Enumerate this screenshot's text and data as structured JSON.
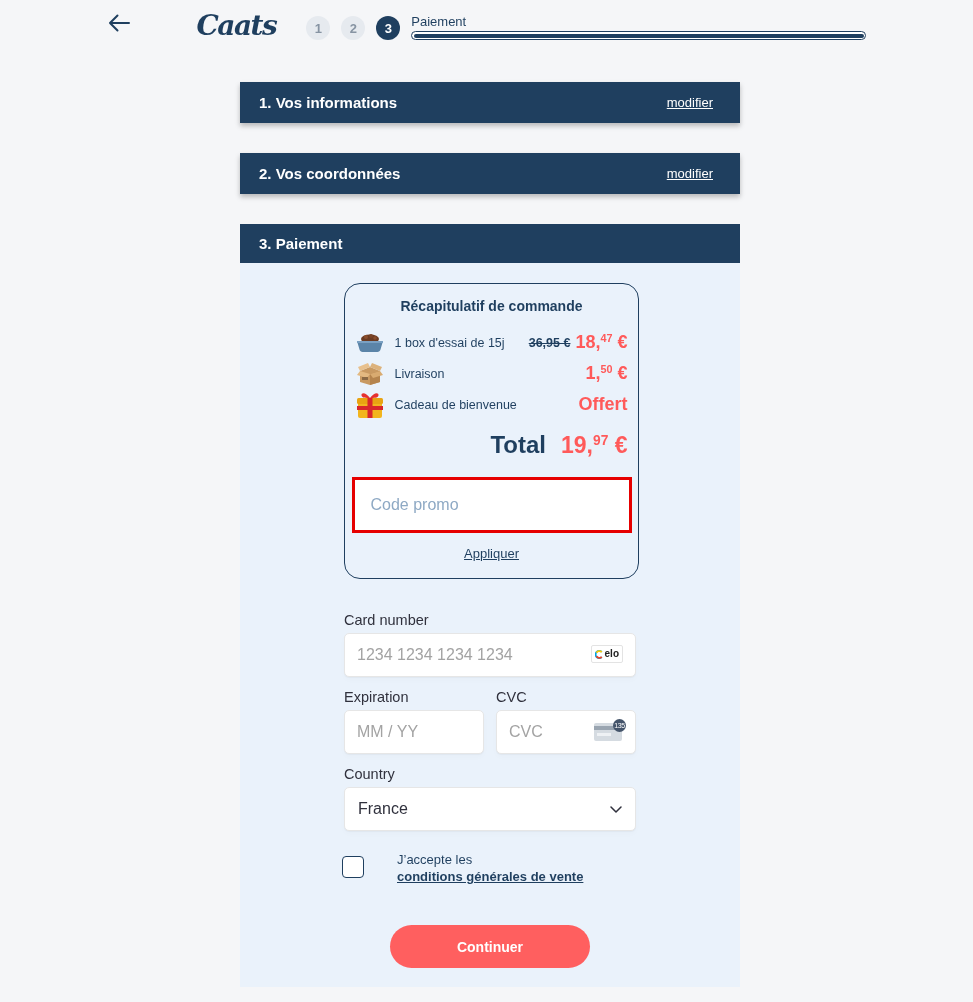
{
  "header": {
    "logo": "Caats",
    "steps": [
      {
        "label": "1",
        "selected": false
      },
      {
        "label": "2",
        "selected": false
      },
      {
        "label": "3",
        "selected": true
      }
    ],
    "step_label": "Paiement",
    "progress": {
      "level": 1
    }
  },
  "sections": [
    {
      "title": "1. Vos informations",
      "action": "modifier",
      "expanded": false
    },
    {
      "title": "2. Vos coordonnées",
      "action": "modifier",
      "expanded": false
    },
    {
      "title": "3. Paiement",
      "expanded": true
    }
  ],
  "order_summary": {
    "title": "Récapitulatif de commande",
    "items": [
      {
        "kind": "bowl",
        "label": "1 box d'essai de 15j",
        "old_price": "36,95 €",
        "price": "18,$^{47}$ €"
      },
      {
        "kind": "box",
        "label": "Livraison",
        "price": "1,$^{50}$ €"
      },
      {
        "kind": "gift",
        "label": "Cadeau de bienvenue",
        "price": "Offert"
      }
    ],
    "total_label": "Total",
    "total": "19,$^{97}$ €",
    "promo": {
      "placeholder": "Code promo",
      "highlighted": true
    },
    "apply": "Appliquer"
  },
  "card_form": {
    "card_number": {
      "label": "Card number",
      "placeholder": "1234 1234 1234 1234",
      "brand": "elo"
    },
    "expiration": {
      "label": "Expiration",
      "placeholder": "MM / YY"
    },
    "cvc": {
      "label": "CVC",
      "placeholder": "CVC",
      "badge": "135"
    },
    "country": {
      "label": "Country",
      "value": "France"
    }
  },
  "terms": {
    "checked": false,
    "text": "J’accepte les",
    "link": "conditions générales de vente"
  },
  "submit": "Continuer"
}
